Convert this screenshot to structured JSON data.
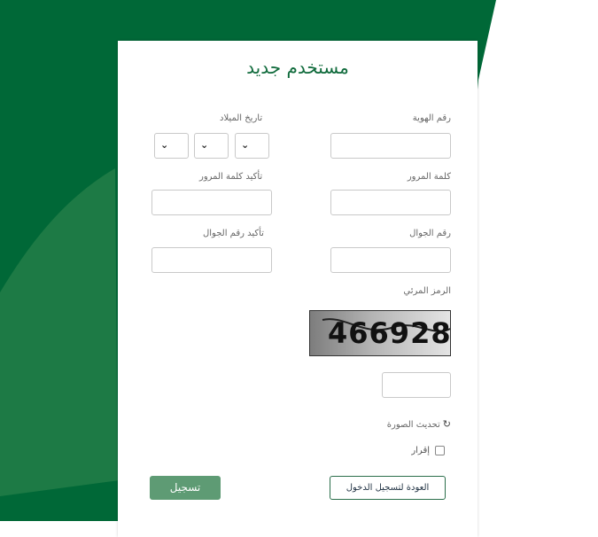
{
  "page": {
    "title": "مستخدم جديد",
    "colors": {
      "primary": "#0f6a3b",
      "dark_green": "#006837",
      "mid_green": "#1d7a45",
      "button_green": "#5e9b74"
    }
  },
  "form": {
    "id_number_label": "رقم الهوية",
    "birth_date_label": "تاريخ الميلاد",
    "password_label": "كلمة المرور",
    "confirm_password_label": "تأكيد كلمة المرور",
    "mobile_label": "رقم الجوال",
    "confirm_mobile_label": "تأكيد رقم الجوال",
    "captcha_label": "الرمز المرئي",
    "captcha_value": "466928",
    "refresh_label": "تحديث الصورة",
    "refresh_icon": "refresh-icon",
    "chevron_icon": "⌄",
    "acknowledge_label": "إقرار",
    "back_button": "العودة لتسجيل الدخول",
    "register_button": "تسجيل"
  }
}
